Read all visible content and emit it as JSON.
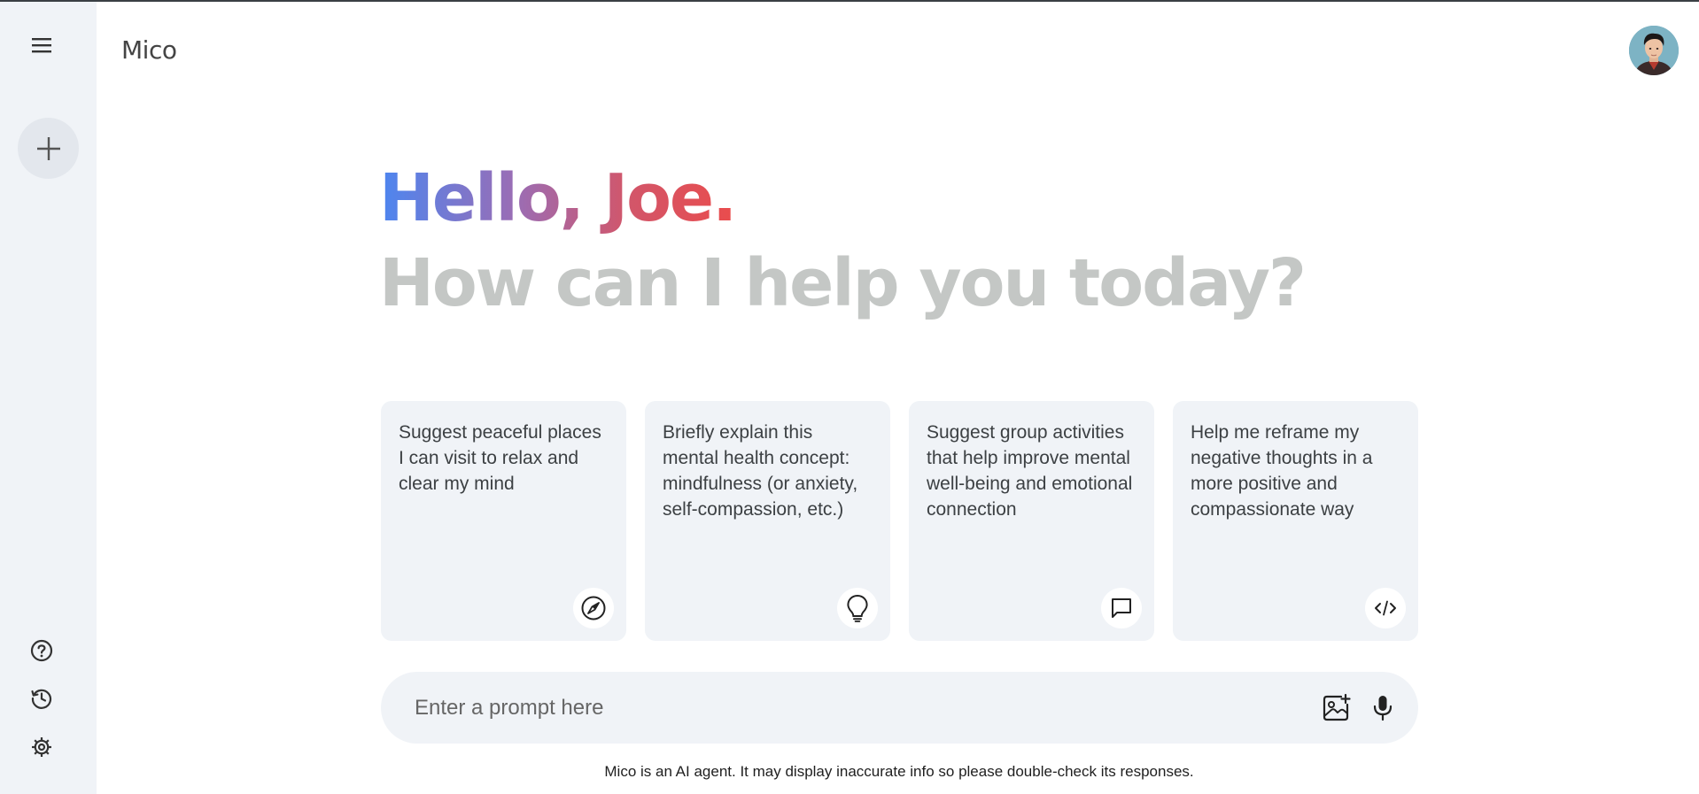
{
  "app": {
    "title": "Mico"
  },
  "sidebar": {
    "menu_icon": "hamburger-menu-icon",
    "new_chat_icon": "plus-icon",
    "bottom_items": [
      {
        "icon": "help-icon"
      },
      {
        "icon": "history-icon"
      },
      {
        "icon": "settings-gear-icon"
      }
    ]
  },
  "header": {
    "avatar_icon": "user-avatar"
  },
  "main": {
    "greeting": "Hello, Joe.",
    "subgreeting": "How can I help you today?",
    "greeting_gradient": [
      "#4c86f0",
      "#9a6db5",
      "#d2566a",
      "#ea4c4c"
    ],
    "subgreeting_color": "#c4c7c5"
  },
  "cards": [
    {
      "text": "Suggest peaceful places I can visit to relax and clear my mind",
      "icon": "compass-icon"
    },
    {
      "text": "Briefly explain this mental health concept: mindfulness (or anxiety, self-compassion, etc.)",
      "icon": "lightbulb-icon"
    },
    {
      "text": "Suggest group activities that help improve mental well-being and emotional connection",
      "icon": "chat-bubble-icon"
    },
    {
      "text": "Help me reframe my negative thoughts in a more positive and compassionate way",
      "icon": "code-icon"
    }
  ],
  "prompt": {
    "placeholder": "Enter a prompt here",
    "value": "",
    "image_icon": "add-image-icon",
    "mic_icon": "microphone-icon"
  },
  "footer": {
    "disclaimer": "Mico is an AI agent. It may display inaccurate info so please double-check its responses."
  },
  "colors": {
    "sidebar_bg": "#f0f3f7",
    "card_bg": "#f0f3f7",
    "text": "#3c4043"
  }
}
